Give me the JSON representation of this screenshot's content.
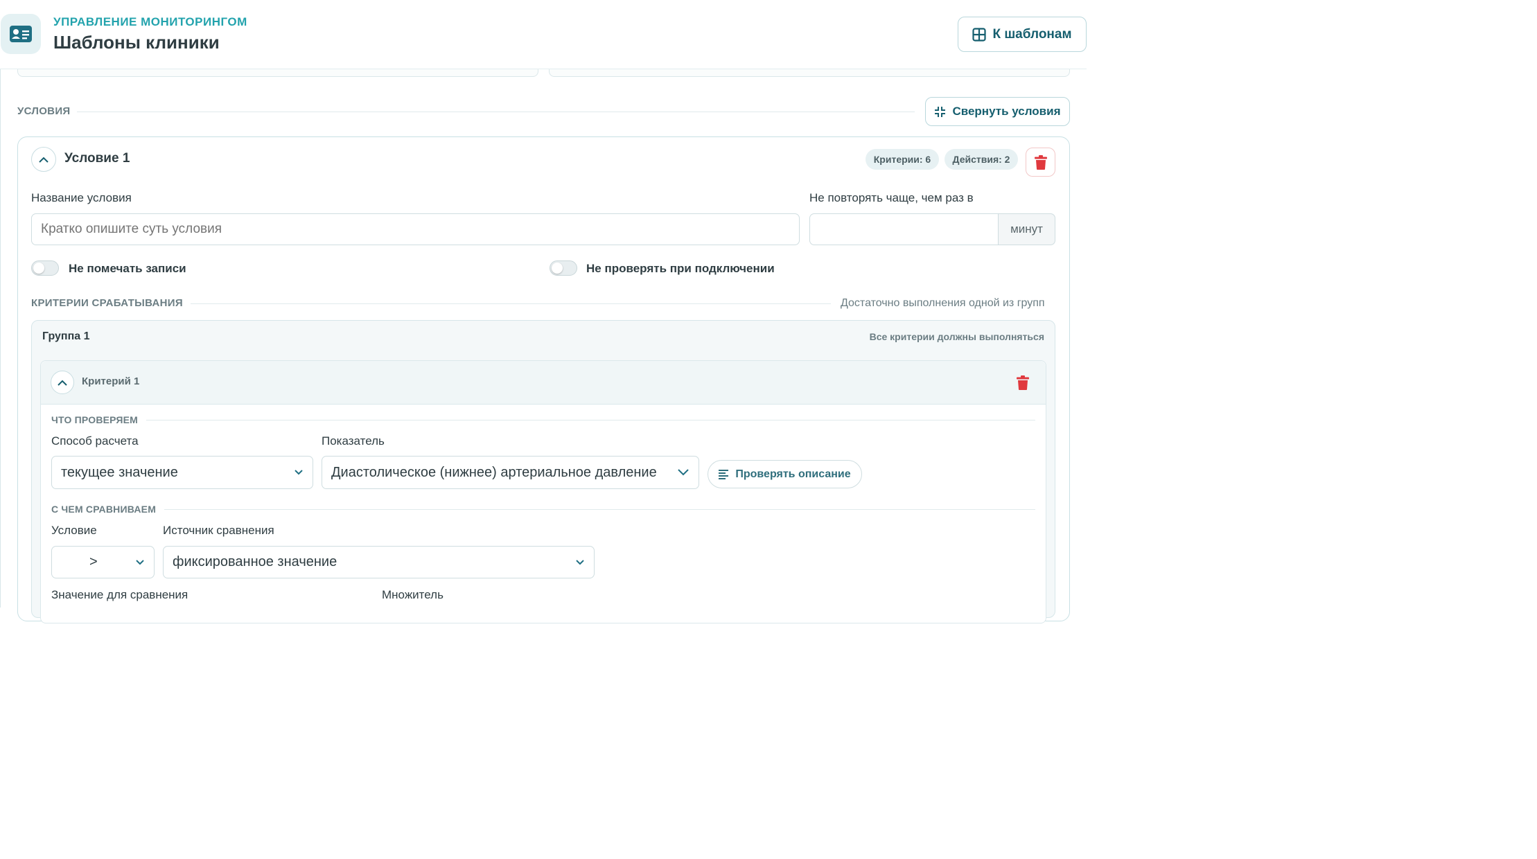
{
  "header": {
    "supertitle": "УПРАВЛЕНИЕ МОНИТОРИНГОМ",
    "title": "Шаблоны клиники",
    "back_button": "К шаблонам"
  },
  "conditions": {
    "section_title": "УСЛОВИЯ",
    "collapse_button": "Свернуть условия",
    "condition": {
      "title": "Условие 1",
      "criteria_badge": "Критерии: 6",
      "actions_badge": "Действия: 2",
      "name_label": "Название условия",
      "name_placeholder": "Кратко опишите суть условия",
      "repeat_label": "Не повторять чаще, чем раз в",
      "repeat_value": "",
      "repeat_unit": "минут",
      "toggle_no_mark": "Не помечать записи",
      "toggle_no_check_on_connect": "Не проверять при подключении",
      "criteria_section": "КРИТЕРИИ СРАБАТЫВАНИЯ",
      "criteria_hint": "Достаточно выполнения одной из групп",
      "group": {
        "title": "Группа 1",
        "hint": "Все критерии должны выполняться",
        "criterion": {
          "title": "Критерий 1",
          "what_section": "ЧТО ПРОВЕРЯЕМ",
          "calc_label": "Способ расчета",
          "calc_value": "текущее значение",
          "indicator_label": "Показатель",
          "indicator_value": "Диастолическое (нижнее) артериальное давление",
          "check_desc_button": "Проверять описание",
          "compare_section": "С ЧЕМ СРАВНИВАЕМ",
          "operator_label": "Условие",
          "operator_value": ">",
          "source_label": "Источник сравнения",
          "source_value": "фиксированное значение",
          "compare_value_label": "Значение для сравнения",
          "multiplier_label": "Множитель"
        }
      }
    }
  },
  "colors": {
    "accent": "#23a3ad",
    "primary_dark": "#155e6e",
    "danger": "#e0393e"
  }
}
